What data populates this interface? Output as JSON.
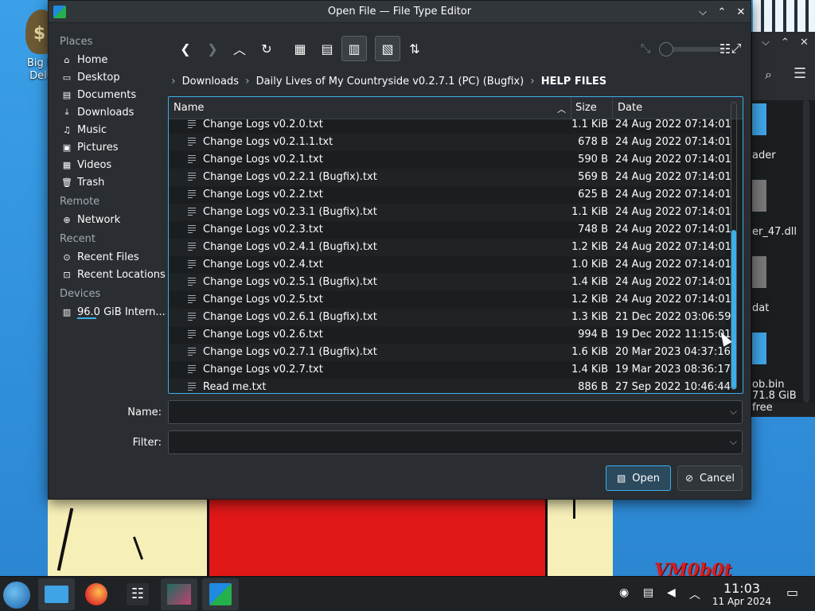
{
  "desktop": {
    "icon_label_line1": "Big M",
    "icon_label_line2": "Delu",
    "icon_glyph": "$",
    "watermark": "VM0b0t"
  },
  "background_window": {
    "files": [
      "ader",
      "er_47.dll",
      "dat",
      "ob.bin"
    ],
    "free_space": "71.8 GiB free"
  },
  "dialog": {
    "title": "Open File — File Type Editor",
    "places": {
      "places_header": "Places",
      "places_items": [
        {
          "label": "Home",
          "icon": "home-icon",
          "glyph": "⌂"
        },
        {
          "label": "Desktop",
          "icon": "desktop-icon",
          "glyph": "▭"
        },
        {
          "label": "Documents",
          "icon": "documents-icon",
          "glyph": "▤"
        },
        {
          "label": "Downloads",
          "icon": "downloads-icon",
          "glyph": "⤓"
        },
        {
          "label": "Music",
          "icon": "music-icon",
          "glyph": "♫"
        },
        {
          "label": "Pictures",
          "icon": "pictures-icon",
          "glyph": "▣"
        },
        {
          "label": "Videos",
          "icon": "videos-icon",
          "glyph": "▦"
        },
        {
          "label": "Trash",
          "icon": "trash-icon",
          "glyph": "🗑"
        }
      ],
      "remote_header": "Remote",
      "remote_items": [
        {
          "label": "Network",
          "icon": "network-icon",
          "glyph": "⊕"
        }
      ],
      "recent_header": "Recent",
      "recent_items": [
        {
          "label": "Recent Files",
          "icon": "recent-files-icon",
          "glyph": "⊙"
        },
        {
          "label": "Recent Locations",
          "icon": "recent-locations-icon",
          "glyph": "⊡"
        }
      ],
      "devices_header": "Devices",
      "device_items": [
        {
          "label": "96.0 GiB Intern...",
          "icon": "drive-icon",
          "glyph": "▥"
        }
      ]
    },
    "breadcrumb": [
      "Downloads",
      "Daily Lives of My Countryside v0.2.7.1 (PC) (Bugfix)",
      "HELP FILES"
    ],
    "columns": {
      "name": "Name",
      "size": "Size",
      "date": "Date"
    },
    "files": [
      {
        "name": "Change Logs v0.2.0.txt",
        "size": "1.1 KiB",
        "date": "24 Aug 2022 07:14:01"
      },
      {
        "name": "Change Logs v0.2.1.1.txt",
        "size": "678 B",
        "date": "24 Aug 2022 07:14:01"
      },
      {
        "name": "Change Logs v0.2.1.txt",
        "size": "590 B",
        "date": "24 Aug 2022 07:14:01"
      },
      {
        "name": "Change Logs v0.2.2.1 (Bugfix).txt",
        "size": "569 B",
        "date": "24 Aug 2022 07:14:01"
      },
      {
        "name": "Change Logs v0.2.2.txt",
        "size": "625 B",
        "date": "24 Aug 2022 07:14:01"
      },
      {
        "name": "Change Logs v0.2.3.1 (Bugfix).txt",
        "size": "1.1 KiB",
        "date": "24 Aug 2022 07:14:01"
      },
      {
        "name": "Change Logs v0.2.3.txt",
        "size": "748 B",
        "date": "24 Aug 2022 07:14:01"
      },
      {
        "name": "Change Logs v0.2.4.1 (Bugfix).txt",
        "size": "1.2 KiB",
        "date": "24 Aug 2022 07:14:01"
      },
      {
        "name": "Change Logs v0.2.4.txt",
        "size": "1.0 KiB",
        "date": "24 Aug 2022 07:14:01"
      },
      {
        "name": "Change Logs v0.2.5.1 (Bugfix).txt",
        "size": "1.4 KiB",
        "date": "24 Aug 2022 07:14:01"
      },
      {
        "name": "Change Logs v0.2.5.txt",
        "size": "1.2 KiB",
        "date": "24 Aug 2022 07:14:01"
      },
      {
        "name": "Change Logs v0.2.6.1 (Bugfix).txt",
        "size": "1.3 KiB",
        "date": "21 Dec 2022 03:06:59"
      },
      {
        "name": "Change Logs v0.2.6.txt",
        "size": "994 B",
        "date": "19 Dec 2022 11:15:01"
      },
      {
        "name": "Change Logs v0.2.7.1 (Bugfix).txt",
        "size": "1.6 KiB",
        "date": "20 Mar 2023 04:37:16"
      },
      {
        "name": "Change Logs v0.2.7.txt",
        "size": "1.4 KiB",
        "date": "19 Mar 2023 08:36:17"
      },
      {
        "name": "Read me.txt",
        "size": "886 B",
        "date": "27 Sep 2022 10:46:44"
      }
    ],
    "name_label": "Name:",
    "name_value": "",
    "filter_label": "Filter:",
    "filter_value": "",
    "open_button": "Open",
    "cancel_button": "Cancel",
    "accent_color": "#3daee9"
  },
  "taskbar": {
    "time": "11:03",
    "date": "11 Apr 2024"
  }
}
